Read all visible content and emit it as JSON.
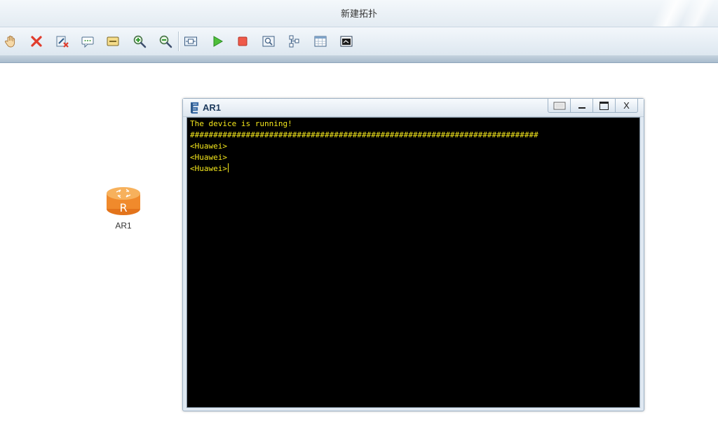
{
  "window": {
    "title": "新建拓扑"
  },
  "toolbar": {
    "buttons": [
      {
        "name": "hand-tool-button",
        "icon": "hand-icon"
      },
      {
        "name": "delete-button",
        "icon": "red-x-icon"
      },
      {
        "name": "delete-link-button",
        "icon": "link-delete-icon"
      },
      {
        "name": "text-note-button",
        "icon": "speech-bubble-icon"
      },
      {
        "name": "rectangle-button",
        "icon": "rectangle-icon"
      },
      {
        "name": "zoom-in-button",
        "icon": "zoom-in-icon"
      },
      {
        "name": "zoom-out-button",
        "icon": "zoom-out-icon"
      },
      {
        "name": "fit-view-button",
        "icon": "fit-view-icon"
      },
      {
        "name": "start-device-button",
        "icon": "play-icon"
      },
      {
        "name": "stop-device-button",
        "icon": "stop-icon"
      },
      {
        "name": "capture-button",
        "icon": "capture-icon"
      },
      {
        "name": "topology-button",
        "icon": "topology-icon"
      },
      {
        "name": "grid-button",
        "icon": "grid-icon"
      },
      {
        "name": "console-button",
        "icon": "console-icon"
      }
    ]
  },
  "canvas": {
    "device": {
      "label": "AR1",
      "icon": "router-icon",
      "color": "#f08a2c"
    }
  },
  "console": {
    "title": "AR1",
    "buttons": {
      "restore": "restore-icon",
      "minimize": "_",
      "maximize": "□",
      "close": "X"
    },
    "lines": [
      "The device is running!",
      "###########################################################################",
      "<Huawei>",
      "<Huawei>",
      "<Huawei>"
    ],
    "text_color": "#f4e71c"
  }
}
